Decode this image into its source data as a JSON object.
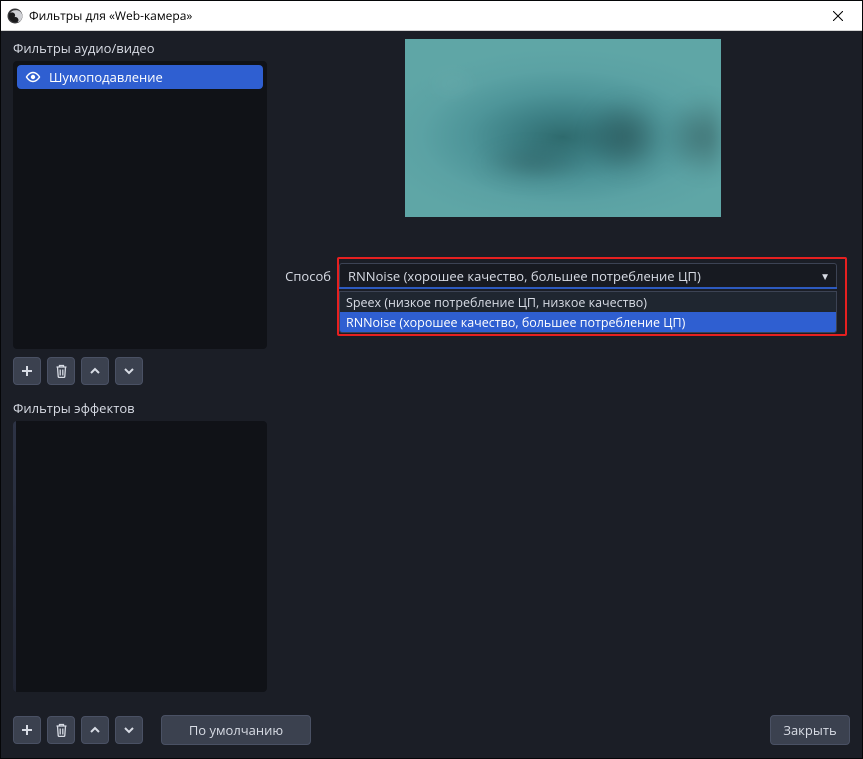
{
  "window": {
    "title": "Фильтры для «Web-камера»"
  },
  "sections": {
    "audio_video": "Фильтры аудио/видео",
    "effects": "Фильтры эффектов"
  },
  "filters": {
    "audio": [
      {
        "label": "Шумоподавление",
        "selected": true
      }
    ],
    "effects": []
  },
  "icons": {
    "add": "add-icon",
    "delete": "trash-icon",
    "up": "chevron-up-icon",
    "down": "chevron-down-icon",
    "visibility": "eye-icon",
    "close": "close-icon",
    "app": "obs-logo-icon"
  },
  "options": {
    "method_label": "Способ",
    "selected": "RNNoise (хорошее качество, большее потребление ЦП)",
    "items": [
      "Speex (низкое потребление ЦП, низкое качество)",
      "RNNoise (хорошее качество, большее потребление ЦП)"
    ]
  },
  "buttons": {
    "defaults": "По умолчанию",
    "close": "Закрыть"
  },
  "highlight_color": "#e62020"
}
